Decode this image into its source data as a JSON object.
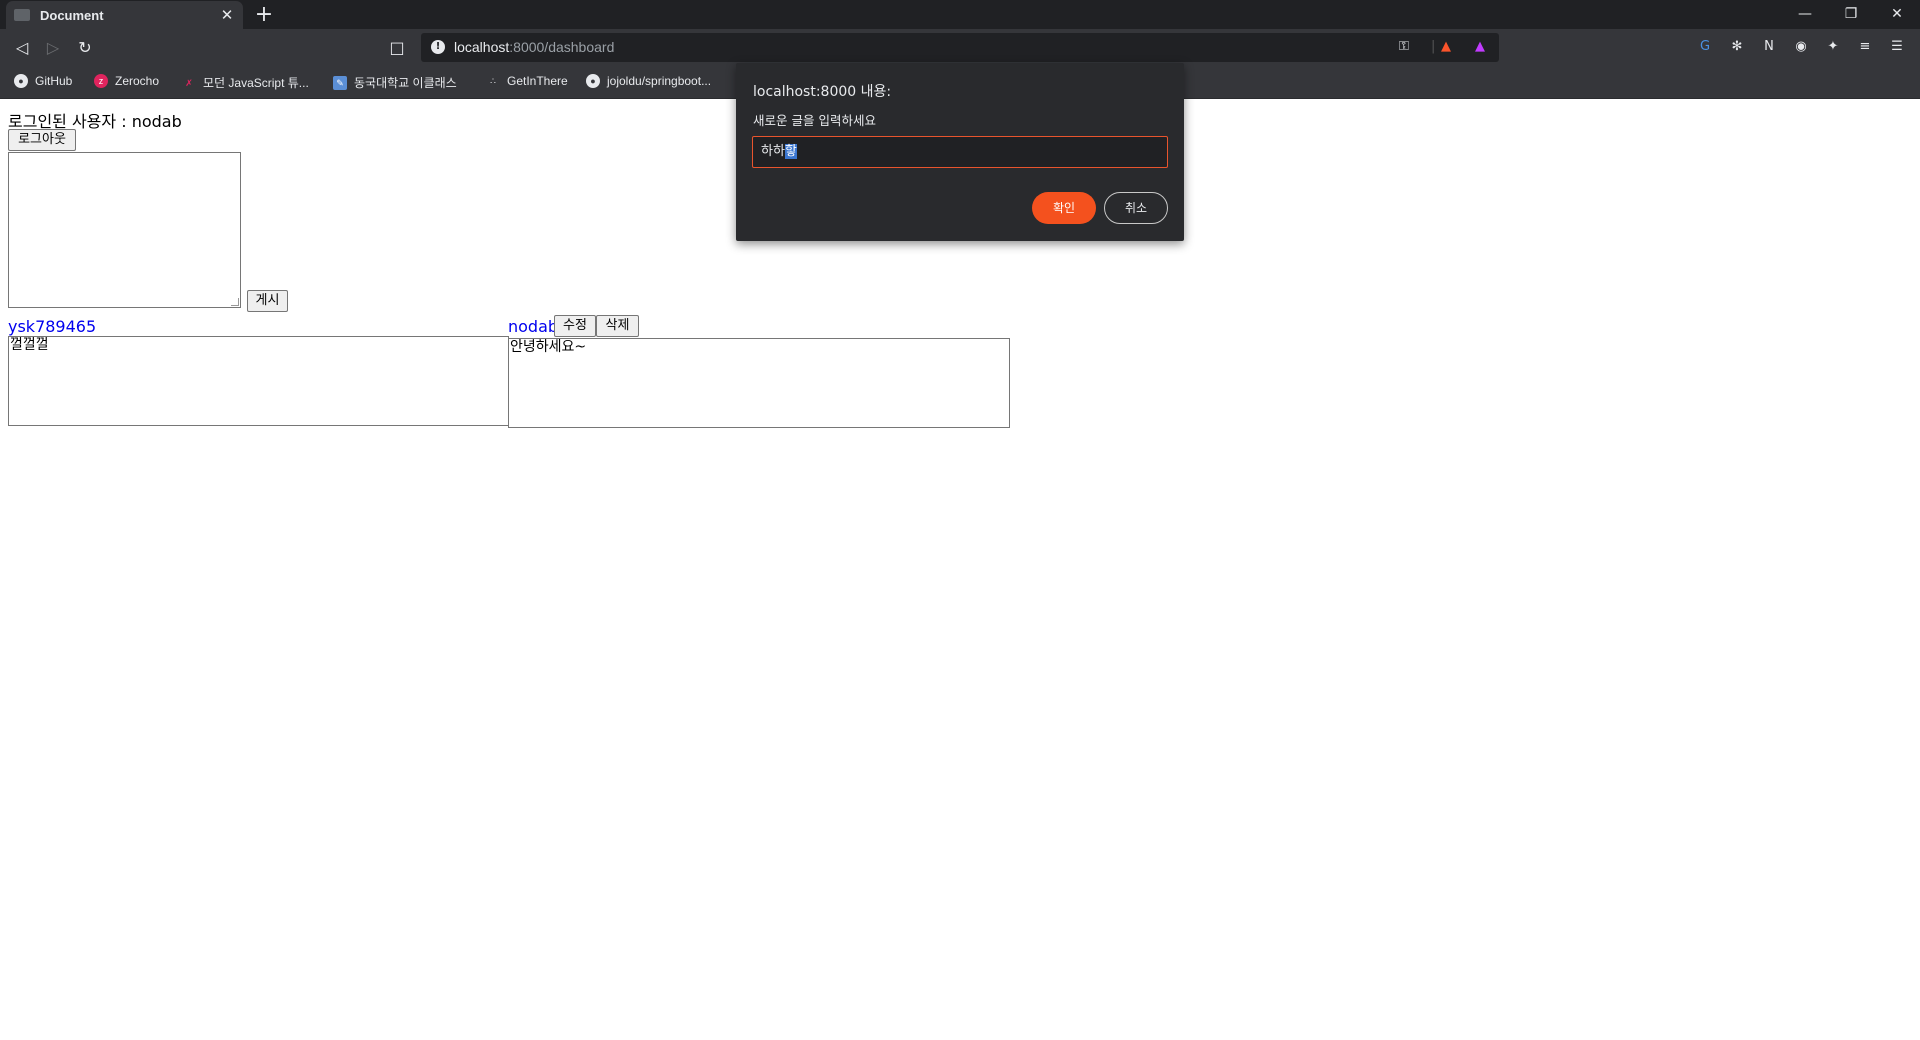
{
  "browser": {
    "tab_title": "Document",
    "tab_close": "✕",
    "new_tab": "+",
    "url_host": "localhost",
    "url_path": ":8000/dashboard",
    "bookmarks": [
      {
        "label": "GitHub",
        "icon": "github-icon"
      },
      {
        "label": "Zerocho",
        "icon": "zerocho-icon"
      },
      {
        "label": "모던 JavaScript 튜...",
        "icon": "javascript-info-icon"
      },
      {
        "label": "동국대학교 이클래스",
        "icon": "eclass-icon"
      },
      {
        "label": "GetInThere",
        "icon": "getinthere-icon"
      },
      {
        "label": "jojoldu/springboot...",
        "icon": "github-icon"
      }
    ],
    "accent_color": "#f4511e"
  },
  "page": {
    "login_text": "로그인된 사용자 : nodab",
    "logout_label": "로그아웃",
    "new_post_value": "",
    "post_button_label": "게시",
    "posts": [
      {
        "author": "ysk789465",
        "content": "껄껄껄"
      },
      {
        "author": "nodab",
        "content": "안녕하세요~",
        "edit_label": "수정",
        "delete_label": "삭제"
      }
    ]
  },
  "dialog": {
    "title": "localhost:8000 내용:",
    "message": "새로운 글을 입력하세요",
    "input_value_plain": "하하",
    "input_value_selected": "핳",
    "ok_label": "확인",
    "cancel_label": "취소"
  }
}
